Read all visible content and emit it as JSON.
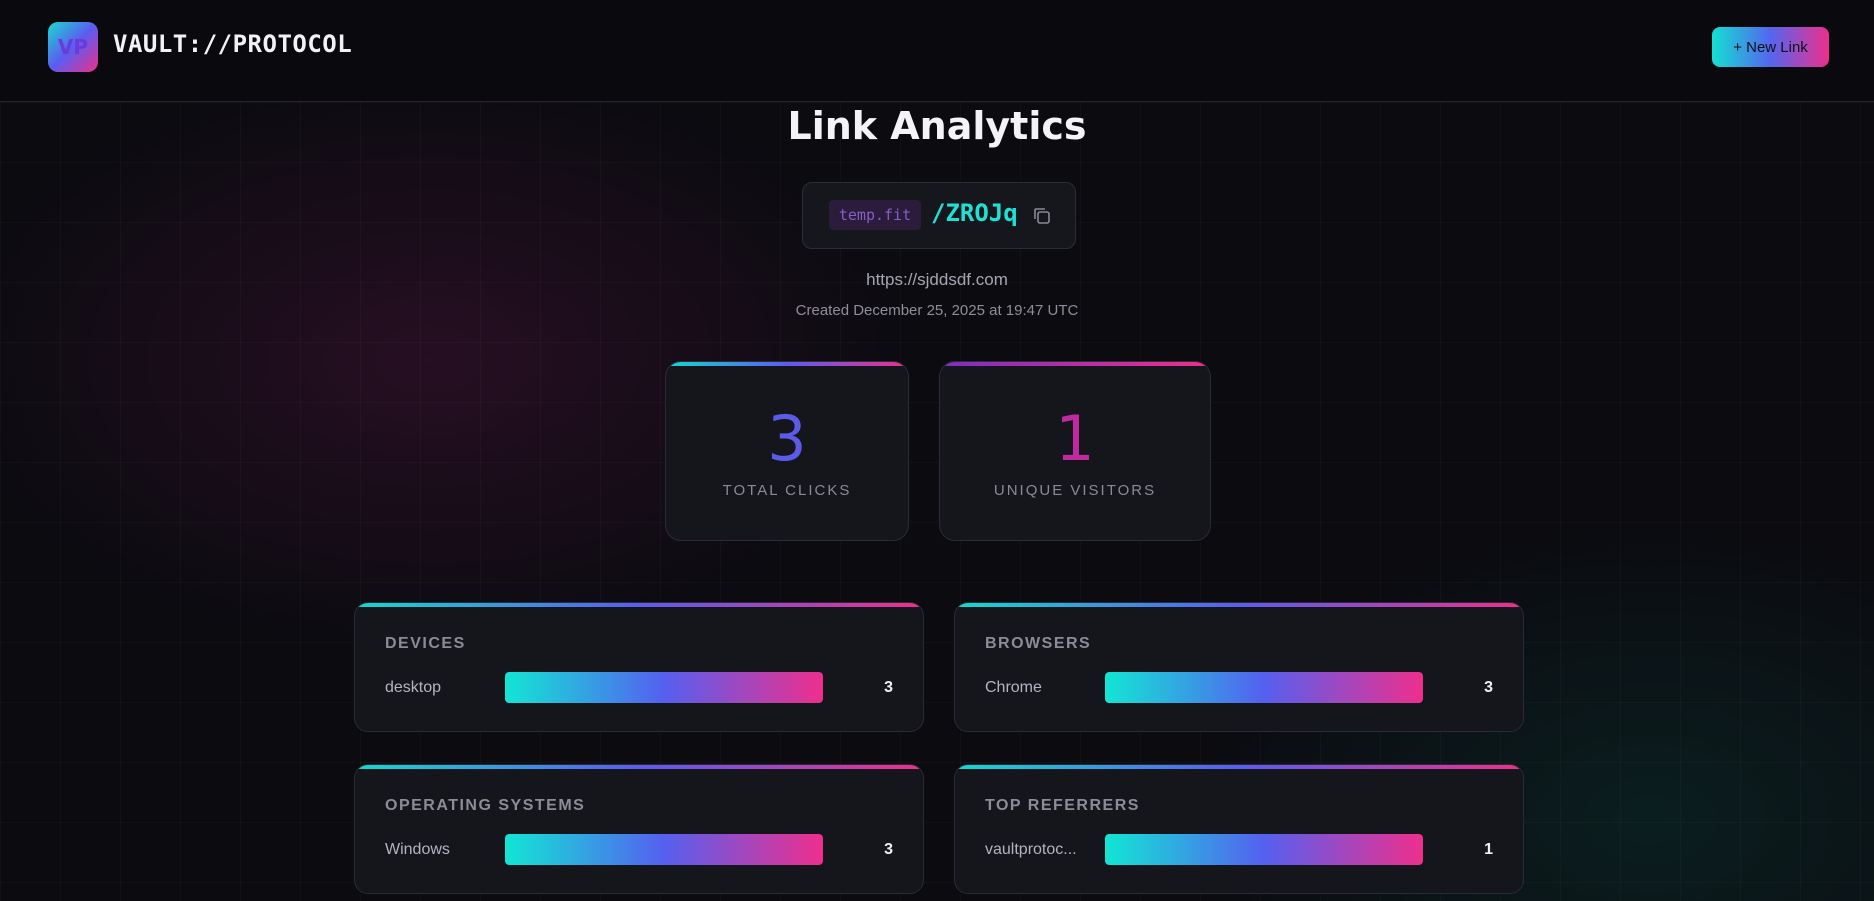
{
  "header": {
    "logo_text": "VP",
    "brand": "VAULT://PROTOCOL",
    "new_link_label": "+ New Link"
  },
  "page": {
    "title": "Link Analytics",
    "domain": "temp.fit",
    "short_code": "/ZROJq",
    "target_url": "https://sjddsdf.com",
    "created": "Created December 25, 2025 at 19:47 UTC"
  },
  "stats": {
    "total_clicks": {
      "value": "3",
      "label": "TOTAL CLICKS"
    },
    "unique_visitors": {
      "value": "1",
      "label": "UNIQUE VISITORS"
    }
  },
  "panels": {
    "devices": {
      "title": "DEVICES",
      "rows": [
        {
          "label": "desktop",
          "count": "3",
          "share": 1.0
        }
      ]
    },
    "browsers": {
      "title": "BROWSERS",
      "rows": [
        {
          "label": "Chrome",
          "count": "3",
          "share": 1.0
        }
      ]
    },
    "operating_systems": {
      "title": "OPERATING SYSTEMS",
      "rows": [
        {
          "label": "Windows",
          "count": "3",
          "share": 1.0
        }
      ]
    },
    "top_referrers": {
      "title": "TOP REFERRERS",
      "rows": [
        {
          "label": "vaultprotoc...",
          "count": "1",
          "share": 1.0
        }
      ]
    }
  },
  "colors": {
    "accent_cyan": "#1fe0d2",
    "accent_purple": "#5b5cf0",
    "accent_pink": "#ee2f8c",
    "background": "#0b0b10"
  },
  "icons": {
    "copy": "copy-icon"
  }
}
